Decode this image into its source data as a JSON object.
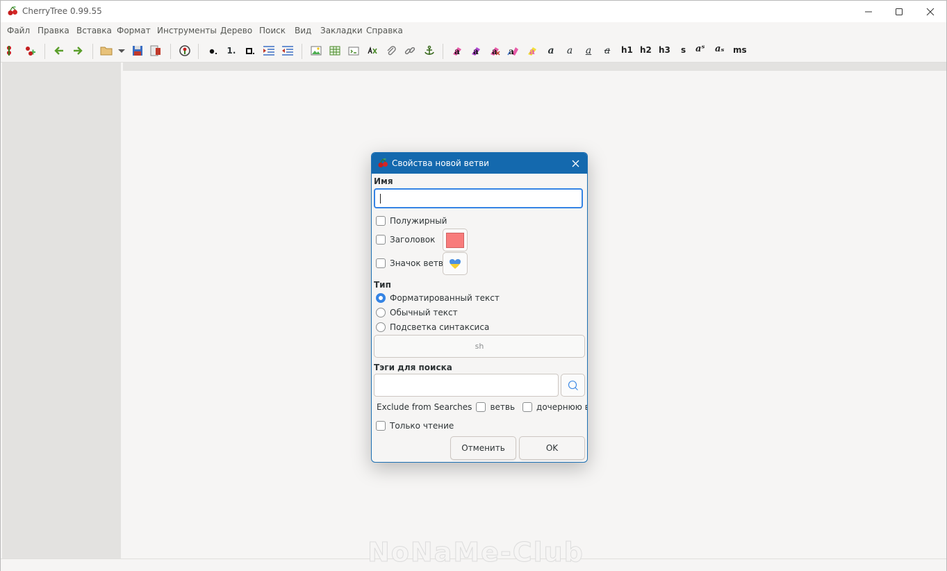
{
  "window": {
    "title": "CherryTree 0.99.55",
    "controls": [
      "minimize-icon",
      "maximize-icon",
      "close-icon"
    ]
  },
  "menu": [
    "Файл",
    "Правка",
    "Вставка",
    "Формат",
    "Инструменты",
    "Дерево",
    "Поиск",
    "Вид",
    "Закладки",
    "Справка"
  ],
  "toolbar": {
    "text_buttons": {
      "bullet": "●.",
      "numbered": "1.",
      "todo": "◘.",
      "bold": "a",
      "italic": "a",
      "underline": "a",
      "strike": "a",
      "h1": "h1",
      "h2": "h2",
      "h3": "h3",
      "small": "s",
      "superscript": "aˢ",
      "subscript": "aₛ",
      "monospace": "ms"
    }
  },
  "dialog": {
    "title": "Свойства новой ветви",
    "name_label": "Имя",
    "name_value": "",
    "bold_label": "Полужирный",
    "header_label": "Заголовок",
    "header_color": "#f87c7c",
    "icon_label": "Значок ветви",
    "type_label": "Тип",
    "type_options": [
      "Форматированный текст",
      "Обычный текст",
      "Подсветка синтаксиса"
    ],
    "type_selected": 0,
    "syntax_value": "sh",
    "tags_label": "Тэги для поиска",
    "tags_value": "",
    "exclude_label": "Exclude from Searches",
    "exclude_node_label": "ветвь",
    "exclude_children_label": "дочернюю ветвь",
    "readonly_label": "Только чтение",
    "cancel_label": "Отменить",
    "ok_label": "OK"
  },
  "watermark": "NoNaMe-Club",
  "colors": {
    "dialog_titlebar": "#1469ae",
    "accent": "#3584e4"
  }
}
